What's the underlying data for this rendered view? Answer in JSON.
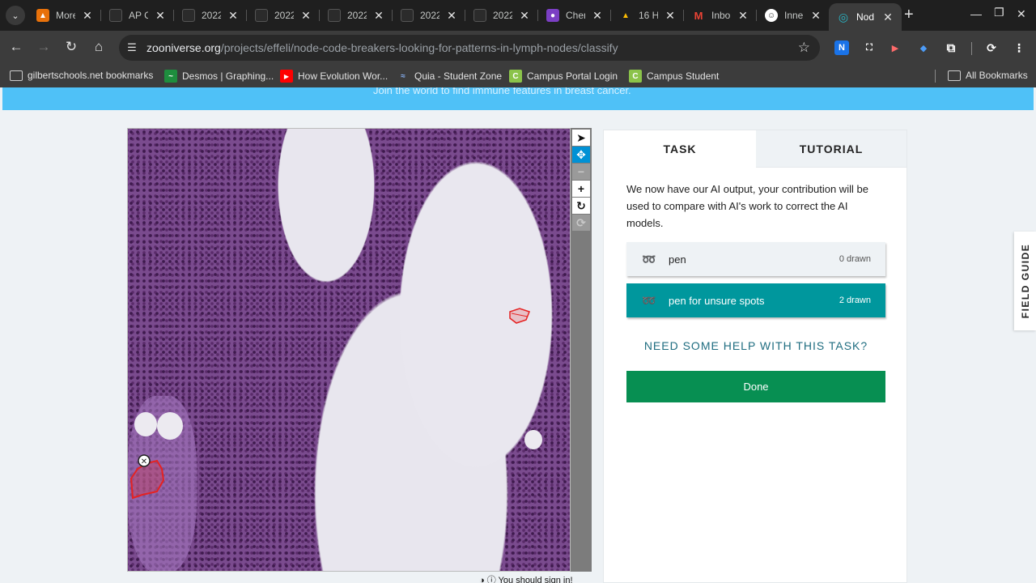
{
  "browser": {
    "tabs": [
      {
        "title": "More",
        "favicon_color": "#e8710a",
        "favicon_glyph": "person-icon"
      },
      {
        "title": "AP C",
        "favicon_color": "#2b2b2b",
        "favicon_glyph": "shield-icon"
      },
      {
        "title": "2022",
        "favicon_color": "#2b2b2b",
        "favicon_glyph": "shield-icon"
      },
      {
        "title": "2022",
        "favicon_color": "#2b2b2b",
        "favicon_glyph": "shield-icon"
      },
      {
        "title": "2022",
        "favicon_color": "#2b2b2b",
        "favicon_glyph": "shield-icon"
      },
      {
        "title": "2022",
        "favicon_color": "#2b2b2b",
        "favicon_glyph": "shield-icon"
      },
      {
        "title": "2022",
        "favicon_color": "#2b2b2b",
        "favicon_glyph": "shield-icon"
      },
      {
        "title": "Chen",
        "favicon_color": "#7b3fc4",
        "favicon_glyph": "person-icon"
      },
      {
        "title": "16 H",
        "favicon_color": "#1e8e3e",
        "favicon_glyph": "drive-icon"
      },
      {
        "title": "Inbo",
        "favicon_color": "#c5221f",
        "favicon_glyph": "gmail-icon"
      },
      {
        "title": "Inne",
        "favicon_color": "#ffffff",
        "favicon_glyph": "face-icon"
      },
      {
        "title": "Nod",
        "favicon_color": "#00a0b0",
        "favicon_glyph": "zooniverse-icon"
      }
    ],
    "url_host": "zooniverse.org",
    "url_path": "/projects/effeli/node-code-breakers-looking-for-patterns-in-lymph-nodes/classify",
    "extensions": [
      {
        "label": "N",
        "color": "#1a73e8"
      },
      {
        "label": "⛶",
        "color": "#3c3c3c"
      },
      {
        "label": "▶",
        "color": "#3c3c3c"
      },
      {
        "label": "◆",
        "color": "#3c3c3c"
      }
    ],
    "bookmarks": [
      {
        "label": "gilbertschools.net bookmarks",
        "color": "#3c3c3c",
        "glyph": "▭"
      },
      {
        "label": "Desmos | Graphing...",
        "color": "#1e8e3e",
        "glyph": "D"
      },
      {
        "label": "How Evolution Wor...",
        "color": "#ff0000",
        "glyph": "▶"
      },
      {
        "label": "Quia - Student Zone",
        "color": "#3c3c3c",
        "glyph": "~"
      },
      {
        "label": "Campus Portal Login",
        "color": "#8bc34a",
        "glyph": "C"
      },
      {
        "label": "Campus Student",
        "color": "#8bc34a",
        "glyph": "C"
      }
    ],
    "all_bookmarks": "All Bookmarks"
  },
  "page": {
    "banner": "Join the world to find immune features in breast cancer.",
    "signin_hint": "You should sign in!",
    "task_tab": "TASK",
    "tutorial_tab": "TUTORIAL",
    "instructions": "We now have our AI output, your contribution will be used to compare with AI's work to correct the AI models.",
    "tools": [
      {
        "label": "pen",
        "count": "0 drawn"
      },
      {
        "label": "pen for unsure spots",
        "count": "2 drawn"
      }
    ],
    "help_link": "NEED SOME HELP WITH THIS TASK?",
    "done": "Done",
    "field_guide": "FIELD GUIDE",
    "accent": "#00979d",
    "done_color": "#078f52"
  }
}
